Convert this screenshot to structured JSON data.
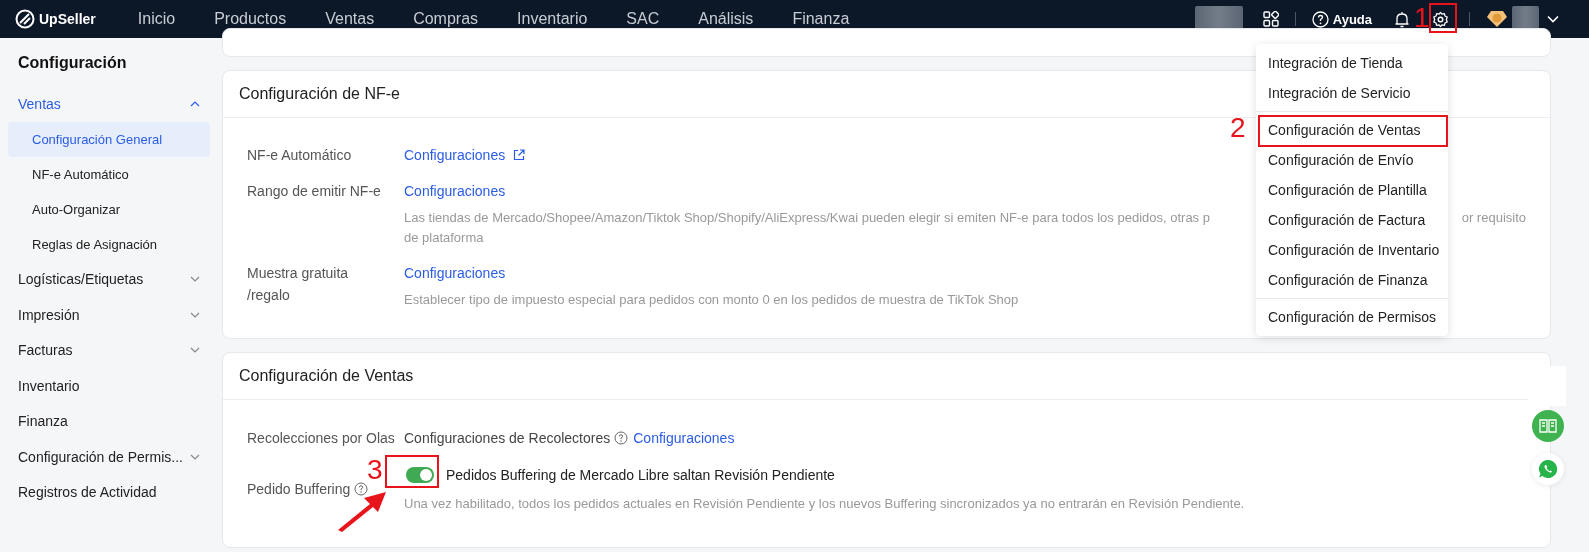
{
  "topbar": {
    "logo": "UpSeller",
    "nav": [
      {
        "label": "Inicio",
        "selected": false
      },
      {
        "label": "Productos",
        "selected": false
      },
      {
        "label": "Ventas",
        "selected": false
      },
      {
        "label": "Compras",
        "selected": false
      },
      {
        "label": "Inventario",
        "selected": false
      },
      {
        "label": "SAC",
        "selected": false
      },
      {
        "label": "Análisis",
        "selected": false
      },
      {
        "label": "Finanza",
        "selected": false
      }
    ],
    "help": "Ayuda"
  },
  "sidebar": {
    "title": "Configuración",
    "items": [
      {
        "label": "Ventas",
        "kind": "group",
        "expanded": true,
        "selected": true,
        "children": [
          {
            "label": "Configuración General",
            "selected": true
          },
          {
            "label": "NF-e Automático",
            "selected": false
          },
          {
            "label": "Auto-Organizar",
            "selected": false
          },
          {
            "label": "Reglas de Asignación",
            "selected": false
          }
        ]
      },
      {
        "label": "Logísticas/Etiquetas",
        "kind": "group",
        "expanded": false,
        "selected": false
      },
      {
        "label": "Impresión",
        "kind": "group",
        "expanded": false,
        "selected": false
      },
      {
        "label": "Facturas",
        "kind": "group",
        "expanded": false,
        "selected": false
      },
      {
        "label": "Inventario",
        "kind": "link",
        "selected": false
      },
      {
        "label": "Finanza",
        "kind": "link",
        "selected": false
      },
      {
        "label": "Configuración de Permis...",
        "kind": "group",
        "expanded": false,
        "selected": false
      },
      {
        "label": "Registros de Actividad",
        "kind": "link",
        "selected": false
      }
    ]
  },
  "nfe_card": {
    "title": "Configuración de NF-e",
    "rows": [
      {
        "label": "NF-e Automático",
        "link": "Configuraciones",
        "external": true
      },
      {
        "label": "Rango de emitir NF-e",
        "link": "Configuraciones",
        "external": false,
        "description": [
          "Las tiendas de Mercado/Shopee/Amazon/Tiktok Shop/Shopify/AliExpress/Kwai pueden elegir si emiten NF-e para todos los pedidos, otras p",
          "or requisito",
          "de plataforma"
        ]
      },
      {
        "label": "Muestra gratuita /regalo",
        "link": "Configuraciones",
        "external": false,
        "description": [
          "Establecer tipo de impuesto especial para pedidos con monto 0 en los pedidos de muestra de TikTok Shop"
        ]
      }
    ]
  },
  "sales_card": {
    "title": "Configuración de Ventas",
    "picking": {
      "label": "Recolecciones por Olas",
      "text": "Configuraciones de Recolectores",
      "link": "Configuraciones"
    },
    "buffering": {
      "label": "Pedido Buffering",
      "on": true,
      "text": "Pedidos Buffering de Mercado Libre saltan Revisión Pendiente",
      "description": "Una vez habilitado, todos los pedidos actuales en Revisión Pendiente y los nuevos Buffering sincronizados ya no entrarán en Revisión Pendiente."
    }
  },
  "settings_menu": {
    "sections": [
      [
        {
          "label": "Integración de Tienda"
        },
        {
          "label": "Integración de Servicio"
        }
      ],
      [
        {
          "label": "Configuración de Ventas"
        },
        {
          "label": "Configuración de Envío"
        },
        {
          "label": "Configuración de Plantilla"
        },
        {
          "label": "Configuración de Factura"
        },
        {
          "label": "Configuración de Inventario"
        },
        {
          "label": "Configuración de Finanza"
        }
      ],
      [
        {
          "label": "Configuración de Permisos"
        }
      ]
    ]
  },
  "annotations": [
    {
      "label": "1"
    },
    {
      "label": "2"
    },
    {
      "label": "3"
    }
  ]
}
